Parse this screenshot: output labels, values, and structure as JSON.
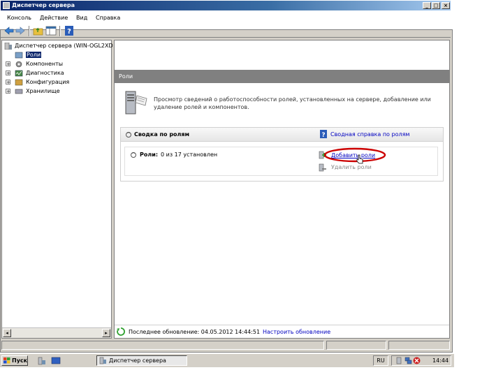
{
  "window": {
    "title": "Диспетчер сервера",
    "minimize": "_",
    "maximize": "□",
    "close": "×"
  },
  "menu": {
    "items": [
      "Консоль",
      "Действие",
      "Вид",
      "Справка"
    ]
  },
  "tree": {
    "root": "Диспетчер сервера (WIN-OGL2XD",
    "items": [
      "Роли",
      "Компоненты",
      "Диагностика",
      "Конфигурация",
      "Хранилище"
    ]
  },
  "pane": {
    "header": "Роли",
    "description": "Просмотр сведений о работоспособности ролей, установленных на сервере, добавление или удаление ролей и компонентов.",
    "section_title": "Сводка по ролям",
    "section_help": "Сводная справка по ролям",
    "roles_label": "Роли:",
    "roles_count": "0 из 17 установлен",
    "add_roles": "Добавить роли",
    "remove_roles": "Удалить роли"
  },
  "status": {
    "last_update": "Последнее обновление: 04.05.2012 14:44:51",
    "configure": "Настроить обновление"
  },
  "taskbar": {
    "start": "Пуск",
    "task": "Диспетчер сервера",
    "lang": "RU",
    "time": "14:44"
  },
  "colors": {
    "titlebar": "#0a246a",
    "link": "#0000c0",
    "highlight": "#cc0000"
  }
}
